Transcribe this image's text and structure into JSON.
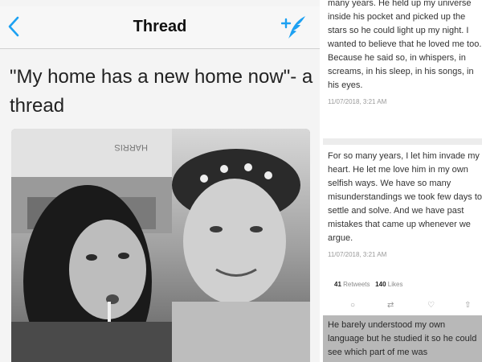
{
  "nav": {
    "title": "Thread"
  },
  "thread": {
    "text": "\"My home has a new home now\"- a thread"
  },
  "icons": {
    "back": "chevron-left-icon",
    "compose": "compose-tweet-icon"
  },
  "colors": {
    "accent": "#1da1f2",
    "photo_dark": "#2b2b2b",
    "photo_light": "#cfcfcf"
  },
  "right": {
    "tweet1": {
      "text": "many years. He held up my universe inside his pocket and picked up the stars so he could light up my night. I wanted to believe that he loved me too. Because he said so, in whispers, in screams, in his sleep, in his songs, in his eyes.",
      "time": "11/07/2018, 3:21 AM"
    },
    "tweet2": {
      "text": "For so many years, I let him invade my heart. He let me love him in my own selfish ways. We have so many misunderstandings we took few days to settle and solve. And we have past mistakes that came up whenever we argue.",
      "time": "11/07/2018, 3:21 AM",
      "retweets": "41",
      "retweets_label": "Retweets",
      "likes": "140",
      "likes_label": "Likes"
    },
    "tweet3": {
      "text": "He barely understood my own language but he studied it so he could see which part of me was"
    }
  }
}
